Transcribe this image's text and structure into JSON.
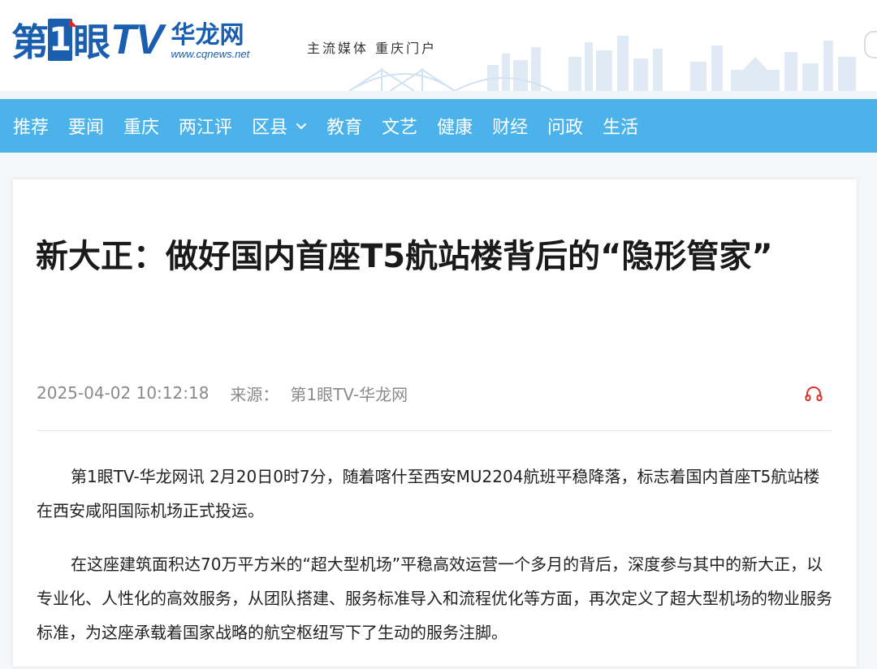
{
  "header": {
    "logo": {
      "di": "第",
      "one": "1",
      "yan": "眼",
      "tv": "TV",
      "hualong": "华龙网",
      "url": "www.cqnews.net"
    },
    "slogan": "主流媒体 重庆门户"
  },
  "nav": {
    "items": [
      {
        "label": "推荐"
      },
      {
        "label": "要闻"
      },
      {
        "label": "重庆"
      },
      {
        "label": "两江评"
      },
      {
        "label": "区县",
        "has_dropdown": true
      },
      {
        "label": "教育"
      },
      {
        "label": "文艺"
      },
      {
        "label": "健康"
      },
      {
        "label": "财经"
      },
      {
        "label": "问政"
      },
      {
        "label": "生活"
      }
    ]
  },
  "article": {
    "title": "新大正：做好国内首座T5航站楼背后的“隐形管家”",
    "date": "2025-04-02 10:12:18",
    "source_label": "来源：",
    "source": "第1眼TV-华龙网",
    "paragraphs": [
      "第1眼TV-华龙网讯 2月20日0时7分，随着喀什至西安MU2204航班平稳降落，标志着国内首座T5航站楼在西安咸阳国际机场正式投运。",
      "在这座建筑面积达70万平方米的“超大型机场”平稳高效运营一个多月的背后，深度参与其中的新大正，以专业化、人性化的高效服务，从团队搭建、服务标准导入和流程优化等方面，再次定义了超大型机场的物业服务标准，为这座承载着国家战略的航空枢纽写下了生动的服务注脚。"
    ]
  },
  "icons": {
    "listen": "headphones-icon",
    "dropdown": "chevron-down-icon"
  },
  "colors": {
    "brand_blue": "#1a5eb0",
    "nav_bg": "#4bb3ea",
    "listen_red": "#d9342b"
  }
}
